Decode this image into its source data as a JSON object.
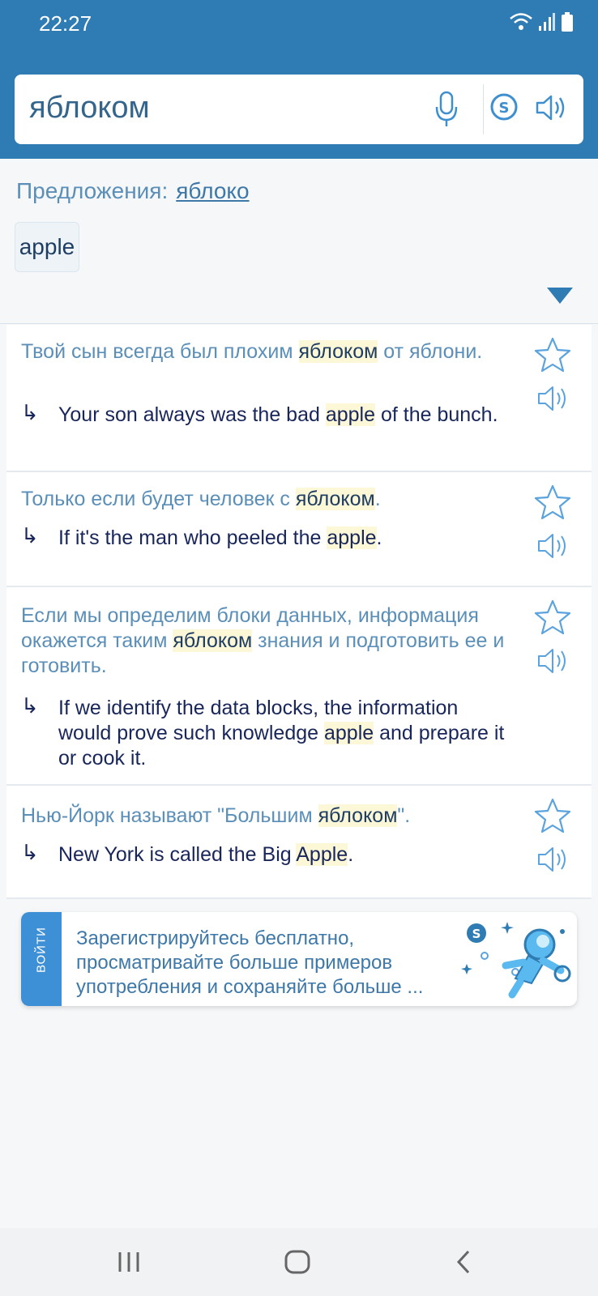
{
  "status_bar": {
    "time": "22:27"
  },
  "search": {
    "query": "яблоком"
  },
  "suggestions": {
    "label": "Предложения:",
    "link": "яблоко",
    "chip": "apple"
  },
  "examples": [
    {
      "ru_pre": "Твой сын всегда был плохим ",
      "ru_hl": "яблоком",
      "ru_post": " от яблони.",
      "en_pre": "Your son always was the bad ",
      "en_hl": "apple",
      "en_post": " of the bunch."
    },
    {
      "ru_pre": "Только если будет человек с ",
      "ru_hl": "яблоком",
      "ru_post": ".",
      "en_pre": "If it's the man who peeled the ",
      "en_hl": "apple",
      "en_post": "."
    },
    {
      "ru_pre": "Если мы определим блоки данных, информация окажется таким ",
      "ru_hl": "яблоком",
      "ru_post": " знания и подготовить ее и готовить.",
      "en_pre": "If we identify the data blocks, the information would prove such knowledge ",
      "en_hl": "apple",
      "en_post": " and prepare it or cook it."
    },
    {
      "ru_pre": "Нью-Йорк называют \"Большим ",
      "ru_hl": "яблоком",
      "ru_post": "\".",
      "en_pre": "New York is called the Big ",
      "en_hl": "Apple",
      "en_post": "."
    }
  ],
  "promo": {
    "tab_label": "ВОЙТИ",
    "text": "Зарегистрируйтесь бесплатно, просматривайте больше примеров употребления и сохраняйте больше ..."
  },
  "colors": {
    "header": "#2f7bb3",
    "accent": "#3d8fd6",
    "highlight": "#fbf7d7"
  }
}
